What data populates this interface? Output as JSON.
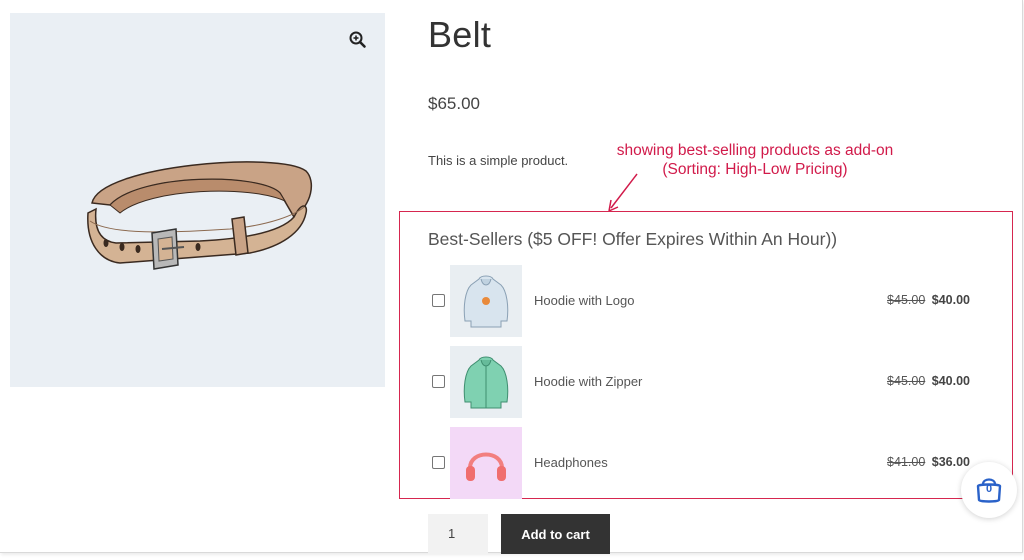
{
  "product": {
    "title": "Belt",
    "price": "$65.00",
    "description": "This is a simple product."
  },
  "annotation": {
    "line1": "showing best-selling products as add-on",
    "line2": "(Sorting: High-Low Pricing)"
  },
  "addons": {
    "heading": "Best-Sellers ($5 OFF! Offer Expires Within An Hour))",
    "items": [
      {
        "name": "Hoodie with Logo",
        "old_price": "$45.00",
        "new_price": "$40.00",
        "checked": false
      },
      {
        "name": "Hoodie with Zipper",
        "old_price": "$45.00",
        "new_price": "$40.00",
        "checked": false
      },
      {
        "name": "Headphones",
        "old_price": "$41.00",
        "new_price": "$36.00",
        "checked": false
      }
    ]
  },
  "cart_form": {
    "quantity": "1",
    "add_to_cart_label": "Add to cart"
  },
  "mini_cart": {
    "count": "0"
  },
  "colors": {
    "accent_annotation": "#d11a4a",
    "button_bg": "#333333",
    "cart_icon": "#2a62c9"
  },
  "icons": {
    "zoom": "zoom-in-icon",
    "cart": "shopping-bag-icon"
  }
}
